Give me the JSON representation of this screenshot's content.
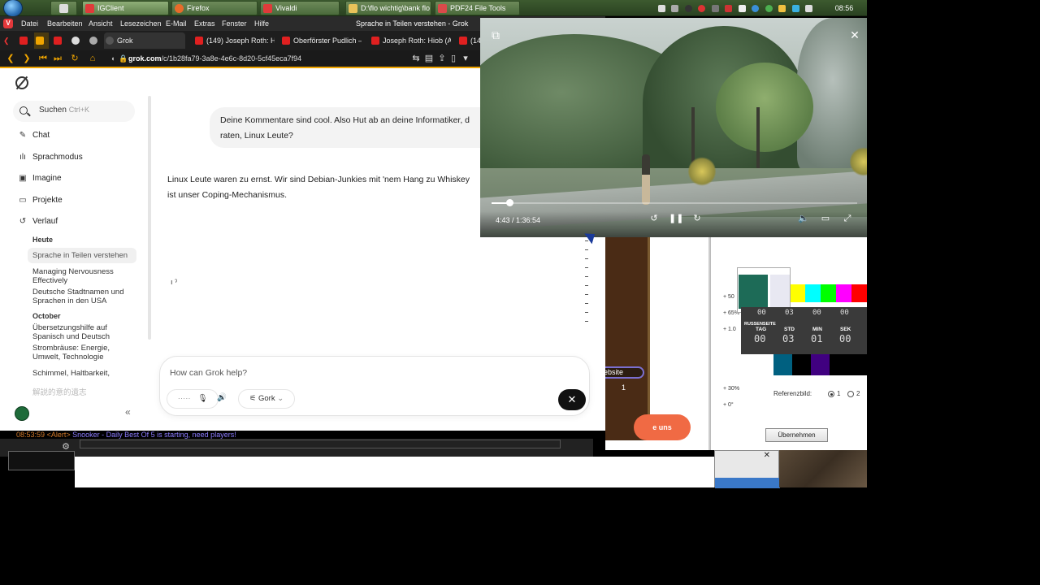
{
  "taskbar": {
    "clock": "08:56",
    "buttons": [
      {
        "label": "IGClient",
        "color": "#e03a3a"
      },
      {
        "label": "Firefox",
        "color": "#e86b2a"
      },
      {
        "label": "Vivaldi",
        "color": "#e03a3a"
      },
      {
        "label": "D:\\flo wichtig\\bank flo",
        "color": "#e8c25a"
      },
      {
        "label": "PDF24 File Tools",
        "color": "#d94a4a"
      }
    ]
  },
  "browser": {
    "window_title": "Sprache in Teilen verstehen - Grok",
    "menu": [
      "Datei",
      "Bearbeiten",
      "Ansicht",
      "Lesezeichen",
      "E-Mail",
      "Extras",
      "Fenster",
      "Hilfe"
    ],
    "tabs": [
      {
        "label": "Grok",
        "color": "#555555"
      },
      {
        "label": "(149) Joseph Roth: Hiob",
        "color": "#e02020"
      },
      {
        "label": "Oberförster Pudlich — D",
        "color": "#e02020"
      },
      {
        "label": "Joseph Roth: Hiob (A/D",
        "color": "#e02020"
      },
      {
        "label": "(14",
        "color": "#e02020"
      }
    ],
    "url_host": "grok.com",
    "url_path": "/c/1b28fa79-3a8e-4e6c-8d20-5cf45eca7f94",
    "accent": "#f0a500"
  },
  "sidebar": {
    "search_label": "Suchen",
    "search_shortcut": "Ctrl+K",
    "nav": [
      {
        "label": "Chat",
        "icon": "chat-icon"
      },
      {
        "label": "Sprachmodus",
        "icon": "voice-wave-icon"
      },
      {
        "label": "Imagine",
        "icon": "image-icon"
      },
      {
        "label": "Projekte",
        "icon": "folder-icon"
      },
      {
        "label": "Verlauf",
        "icon": "history-icon"
      }
    ],
    "history_today_heading": "Heute",
    "history_today": [
      "Sprache in Teilen verstehen",
      "Managing Nervousness Effectively",
      "Deutsche Stadtnamen und Sprachen in den USA"
    ],
    "history_october_heading": "October",
    "history_october": [
      "Übersetzungshilfe auf Spanisch und Deutsch",
      "Strombräuse: Energie, Umwelt, Technologie",
      "Schimmel, Haltbarkeit,",
      "解説的意的遺志"
    ]
  },
  "chat": {
    "user_message": "Deine Kommentare sind cool. Also Hut ab an deine Informatiker, d raten, Linux Leute?",
    "user_line1": "Deine Kommentare sind cool. Also Hut ab an deine Informatiker, d",
    "user_line2": "raten, Linux Leute?",
    "reply_line1": "Linux Leute waren zu ernst. Wir sind Debian-Junkies mit 'nem Hang zu Whiskey",
    "reply_line2": "ist unser Coping-Mechanismus.",
    "mini_glyph": "ı ˀ",
    "input_placeholder": "How can Grok help?",
    "model_label": "Gork",
    "send_icon": "close-icon"
  },
  "video": {
    "time_label": "4:43 / 1:36:54",
    "progress_fraction": 0.0487
  },
  "background_app": {
    "website_label": "ebsite",
    "counter_value": "1",
    "red_button_label": "e uns",
    "irc_time": "08:53:59",
    "irc_alert": "<Alert>",
    "irc_text": "Snooker - Daily Best Of 5 is starting, need players!",
    "percent_labels": [
      "+ 50",
      "+ 65%",
      "+ 1.0",
      "+ 30%",
      "+ 0°"
    ],
    "ref_label": "Referenzbild:",
    "radio_options": [
      "1",
      "2"
    ],
    "apply_button": "Übernehmen",
    "countdown": {
      "title": "RUSSENSEITE",
      "row1": [
        "00",
        "03",
        "00",
        "00"
      ],
      "labels": [
        "TAG",
        "STD",
        "MIN",
        "SEK"
      ],
      "row2": [
        "00",
        "03",
        "01",
        "00"
      ]
    },
    "color_bars": [
      "#ffff00",
      "#00ffff",
      "#00ff00",
      "#ff00ff",
      "#ff0000"
    ],
    "dark_bars": [
      "#006080",
      "#000000",
      "#400080",
      "#000000",
      "#000000"
    ]
  }
}
